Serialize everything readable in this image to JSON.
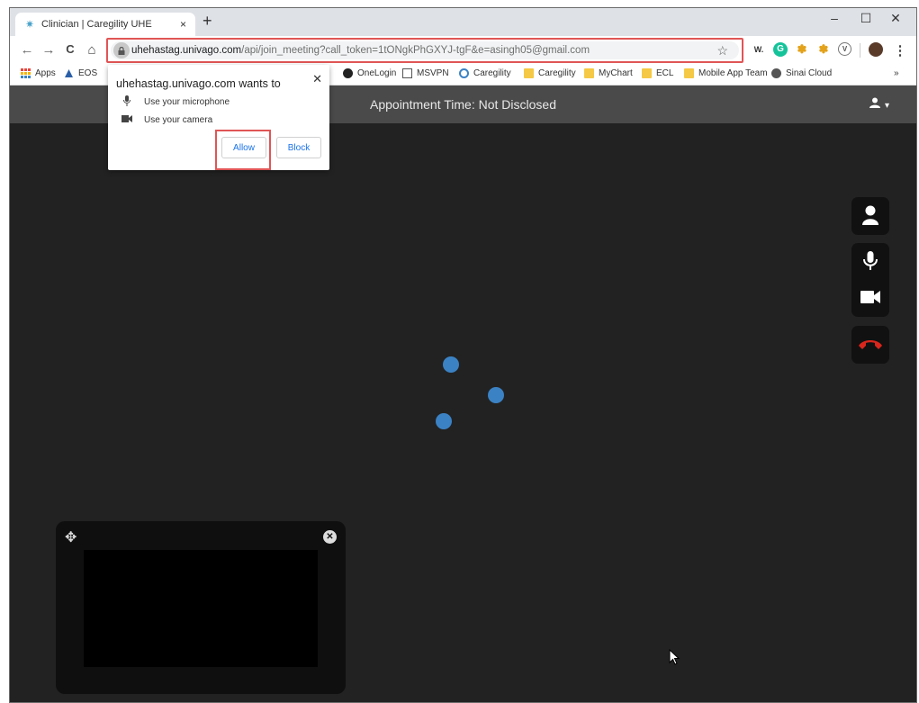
{
  "tab": {
    "title": "Clinician | Caregility UHE",
    "close": "×",
    "new_tab": "+"
  },
  "window_controls": {
    "minimize": "–",
    "maximize": "☐",
    "close": "✕"
  },
  "toolbar": {
    "back": "←",
    "forward": "→",
    "reload": "C",
    "home": "⌂",
    "url_host": "uhehastag.univago.com",
    "url_path": "/api/join_meeting?call_token=1tONgkPhGXYJ-tgF&e=asingh05@gmail.com",
    "star": "☆",
    "menu": "⋮"
  },
  "extensions": [
    {
      "name": "w-extension-icon",
      "label": "W.",
      "color": "#333333",
      "bg": "#ffffff"
    },
    {
      "name": "grammarly-icon",
      "label": "G",
      "color": "#ffffff",
      "bg": "#15c39a"
    },
    {
      "name": "pinwheel-icon-1",
      "label": "✽",
      "color": "#e3a21a",
      "bg": "#ffffff"
    },
    {
      "name": "pinwheel-icon-2",
      "label": "✽",
      "color": "#e3a21a",
      "bg": "#ffffff"
    },
    {
      "name": "vpn-icon",
      "label": "V",
      "color": "#555555",
      "bg": "#ffffff"
    },
    {
      "name": "profile-icon",
      "label": "",
      "color": "#ffffff",
      "bg": "#5a3b2a"
    }
  ],
  "bookmarks": {
    "apps": "Apps",
    "eos": "EOS",
    "items": [
      "OneLogin",
      "MSVPN",
      "Caregility",
      "Caregility",
      "MyChart",
      "ECL",
      "Mobile App Team",
      "Sinai Cloud"
    ],
    "overflow": "»"
  },
  "app": {
    "appointment_time": "Appointment Time: Not Disclosed",
    "user_menu": "▾"
  },
  "permission_popup": {
    "title": "uhehastag.univago.com wants to",
    "close": "✕",
    "mic": "Use your microphone",
    "camera": "Use your camera",
    "allow": "Allow",
    "block": "Block"
  },
  "colors": {
    "highlight": "#e05555",
    "accent": "#3b82c4",
    "hangup": "#d9261c"
  }
}
